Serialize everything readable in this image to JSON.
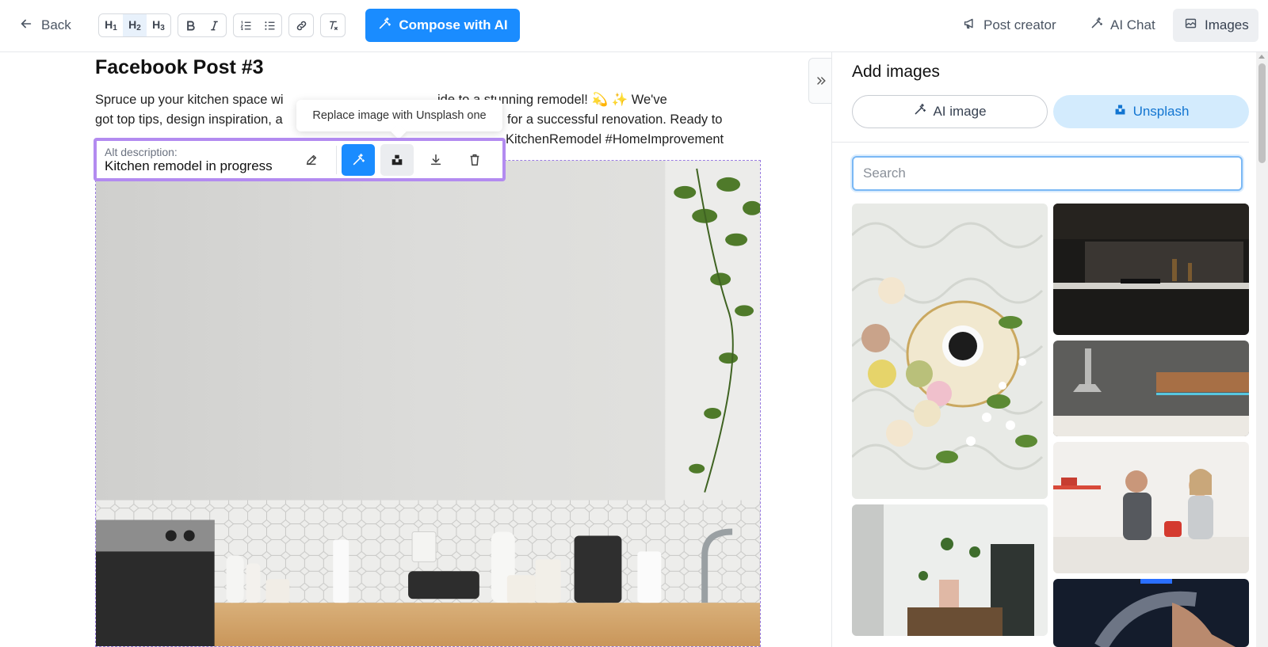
{
  "toolbar": {
    "back_label": "Back",
    "compose_label": "Compose with AI",
    "headings": [
      {
        "letter": "H",
        "num": "1"
      },
      {
        "letter": "H",
        "num": "2"
      },
      {
        "letter": "H",
        "num": "3"
      }
    ],
    "right_tabs": {
      "post_creator": "Post creator",
      "ai_chat": "AI Chat",
      "images": "Images"
    },
    "active_tab": "Images",
    "active_heading": "H2",
    "accent_color": "#1a8cff"
  },
  "editor": {
    "title": "Facebook Post #3",
    "body": "Spruce up your kitchen space wi… ide to a stunning remodel! 💫 ✨ We've got top tips, design inspiration, a… for a successful renovation. Ready to … KitchenRemodel #HomeImprovement",
    "body_lines": [
      "Spruce up your kitchen space wi",
      "ide to a stunning remodel! 💫 ✨ We've",
      "got top tips, design inspiration, a",
      "for a successful renovation. Ready to",
      "KitchenRemodel #HomeImprovement"
    ],
    "tooltip": "Replace image with Unsplash one",
    "alt_label": "Alt description:",
    "alt_value": "Kitchen remodel in progress",
    "highlight_color": "#b38bf0"
  },
  "panel": {
    "title": "Add images",
    "ai_image_label": "AI image",
    "unsplash_label": "Unsplash",
    "active_source": "Unsplash",
    "search_placeholder": "Search",
    "search_value": ""
  },
  "icons": {
    "back": "arrow-left-icon",
    "compose": "magic-wand-icon",
    "post_creator": "megaphone-icon",
    "ai_chat": "magic-wand-icon",
    "images": "image-icon",
    "collapse": "double-chevron-right-icon"
  }
}
